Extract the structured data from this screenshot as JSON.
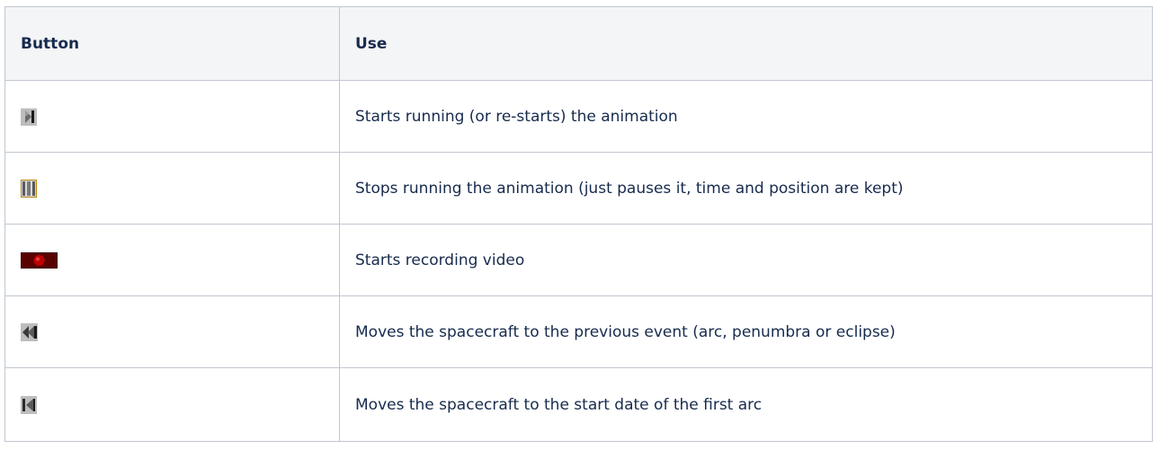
{
  "table": {
    "headers": [
      "Button",
      "Use"
    ],
    "rows": [
      {
        "icon": "play-icon",
        "use": "Starts running (or re-starts) the animation"
      },
      {
        "icon": "pause-icon",
        "use": "Stops running the animation (just pauses it, time and position are kept)"
      },
      {
        "icon": "record-icon",
        "use": "Starts recording video"
      },
      {
        "icon": "previous-event-icon",
        "use": "Moves the spacecraft to the previous event (arc, penumbra or eclipse)"
      },
      {
        "icon": "first-arc-start-icon",
        "use": "Moves the spacecraft to the start date of the first arc"
      }
    ]
  },
  "colors": {
    "header_bg": "#f4f5f7",
    "border": "#c1c7d0",
    "text": "#172b4d",
    "icon_gray": "#8a8a8a",
    "icon_dark": "#2e2e2e",
    "pause_gold": "#b8860b",
    "record_red": "#c00000"
  }
}
